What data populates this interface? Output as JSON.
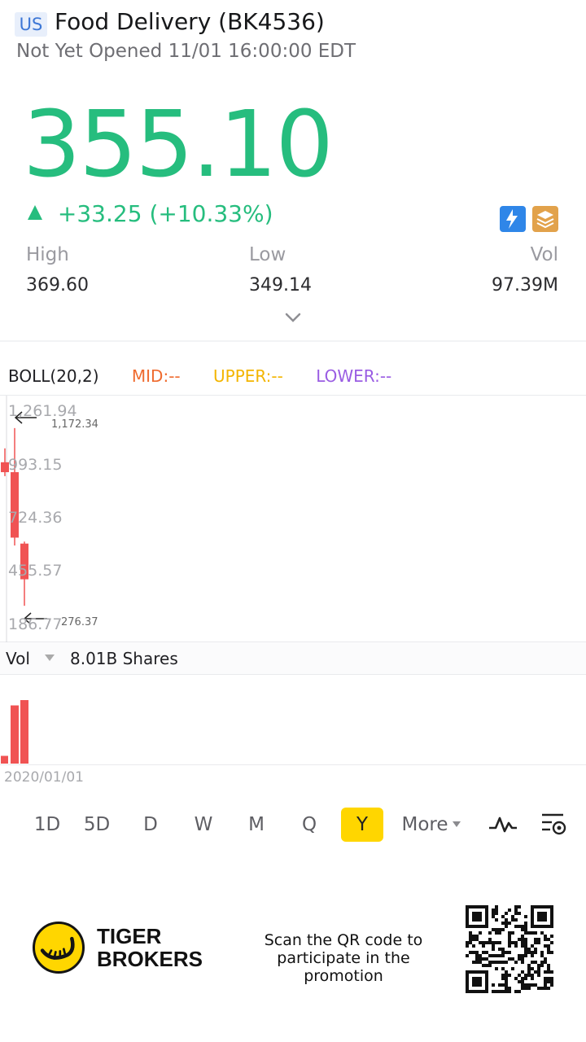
{
  "header": {
    "market_badge": "US",
    "title": "Food Delivery (BK4536)",
    "subtitle": "Not Yet Opened 11/01 16:00:00 EDT"
  },
  "quote": {
    "price": "355.10",
    "change": "+33.25",
    "change_pct": "(+10.33%)",
    "direction": "up",
    "color": "#26bd7e",
    "icons": [
      "flash-icon",
      "layers-icon"
    ]
  },
  "stats": [
    {
      "label": "High",
      "value": "369.60"
    },
    {
      "label": "Low",
      "value": "349.14"
    },
    {
      "label": "Vol",
      "value": "97.39M"
    }
  ],
  "indicator": {
    "name": "BOLL(20,2)",
    "mid": "MID:--",
    "upper": "UPPER:--",
    "lower": "LOWER:--",
    "colors": {
      "mid": "#ef6b2f",
      "upper": "#f3b500",
      "lower": "#9a5de3"
    }
  },
  "price_chart": {
    "axis_labels": [
      "1,261.94",
      "993.15",
      "724.36",
      "455.57",
      "186.77"
    ],
    "high_marker": "1,172.34",
    "low_marker": "276.37"
  },
  "volume": {
    "label": "Vol",
    "value": "8.01B Shares"
  },
  "x_axis": {
    "start_date": "2020/01/01"
  },
  "periods": [
    "1D",
    "5D",
    "D",
    "W",
    "M",
    "Q",
    "Y",
    "More"
  ],
  "active_period": "Y",
  "promo": {
    "brand": "TIGER\nBROKERS",
    "text": "Scan the QR code to\nparticipate in the promotion"
  },
  "chart_data": {
    "type": "candlestick",
    "candles": [
      {
        "open": 1000,
        "close": 950,
        "high": 1070,
        "low": 930
      },
      {
        "open": 950,
        "close": 620,
        "high": 1172.34,
        "low": 580
      },
      {
        "open": 590,
        "close": 410,
        "high": 600,
        "low": 276.37
      }
    ],
    "volumes": [
      0.35,
      2.63,
      2.87
    ],
    "volume_unit": "B Shares",
    "ylim": [
      186.77,
      1261.94
    ],
    "ticks": [
      1261.94,
      993.15,
      724.36,
      455.57,
      186.77
    ]
  }
}
